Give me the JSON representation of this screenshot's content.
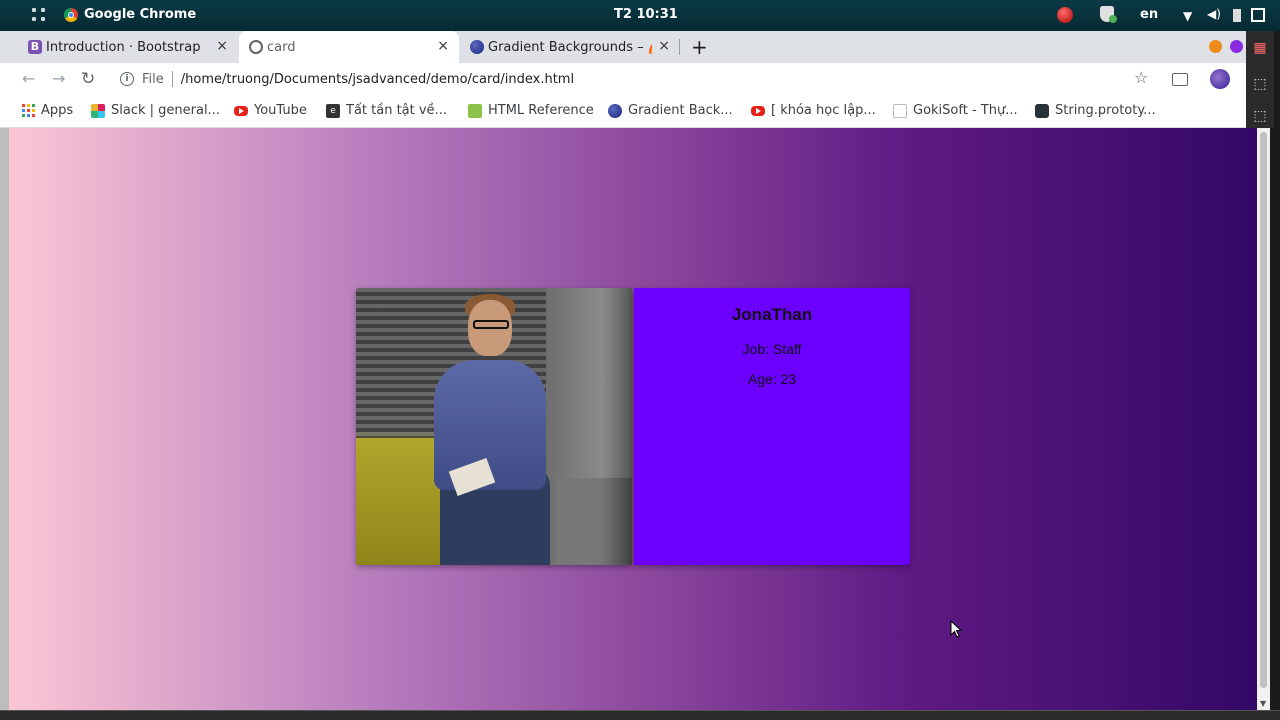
{
  "os_bar": {
    "app_name": "Google Chrome",
    "clock": "T2 10:31",
    "language": "en"
  },
  "tabs": [
    {
      "title": "Introduction · Bootstrap",
      "favicon": "bootstrap-icon",
      "close": "×",
      "active": false
    },
    {
      "title": "card",
      "favicon": "globe-icon",
      "close": "×",
      "active": true
    },
    {
      "title": "Gradient Backgrounds – 🌈",
      "favicon": "gradient-icon",
      "close": "×",
      "active": false
    }
  ],
  "new_tab_label": "+",
  "toolbar": {
    "back": "←",
    "forward": "→",
    "reload": "↻",
    "scheme": "File",
    "url": "/home/truong/Documents/jsadvanced/demo/card/index.html",
    "star": "☆"
  },
  "bookmarks": [
    {
      "label": "Apps",
      "icon": "apps-grid-icon"
    },
    {
      "label": "Slack | general...",
      "icon": "slack-icon"
    },
    {
      "label": "YouTube",
      "icon": "youtube-icon"
    },
    {
      "label": "Tất tần tật về...",
      "icon": "e-icon"
    },
    {
      "label": "HTML Reference",
      "icon": "html-reference-icon"
    },
    {
      "label": "Gradient Back...",
      "icon": "gradient-icon"
    },
    {
      "label": "[ khóa học lập...",
      "icon": "youtube-icon"
    },
    {
      "label": "GokiSoft - Thự...",
      "icon": "gokisoft-icon"
    },
    {
      "label": "String.prototy...",
      "icon": "string-prototype-icon"
    }
  ],
  "card": {
    "name": "JonaThan",
    "job": "Job: Staff",
    "age": "Age: 23",
    "info_color": "#6b00ff"
  },
  "page_gradient": [
    "#fbc7d4",
    "#330867"
  ]
}
